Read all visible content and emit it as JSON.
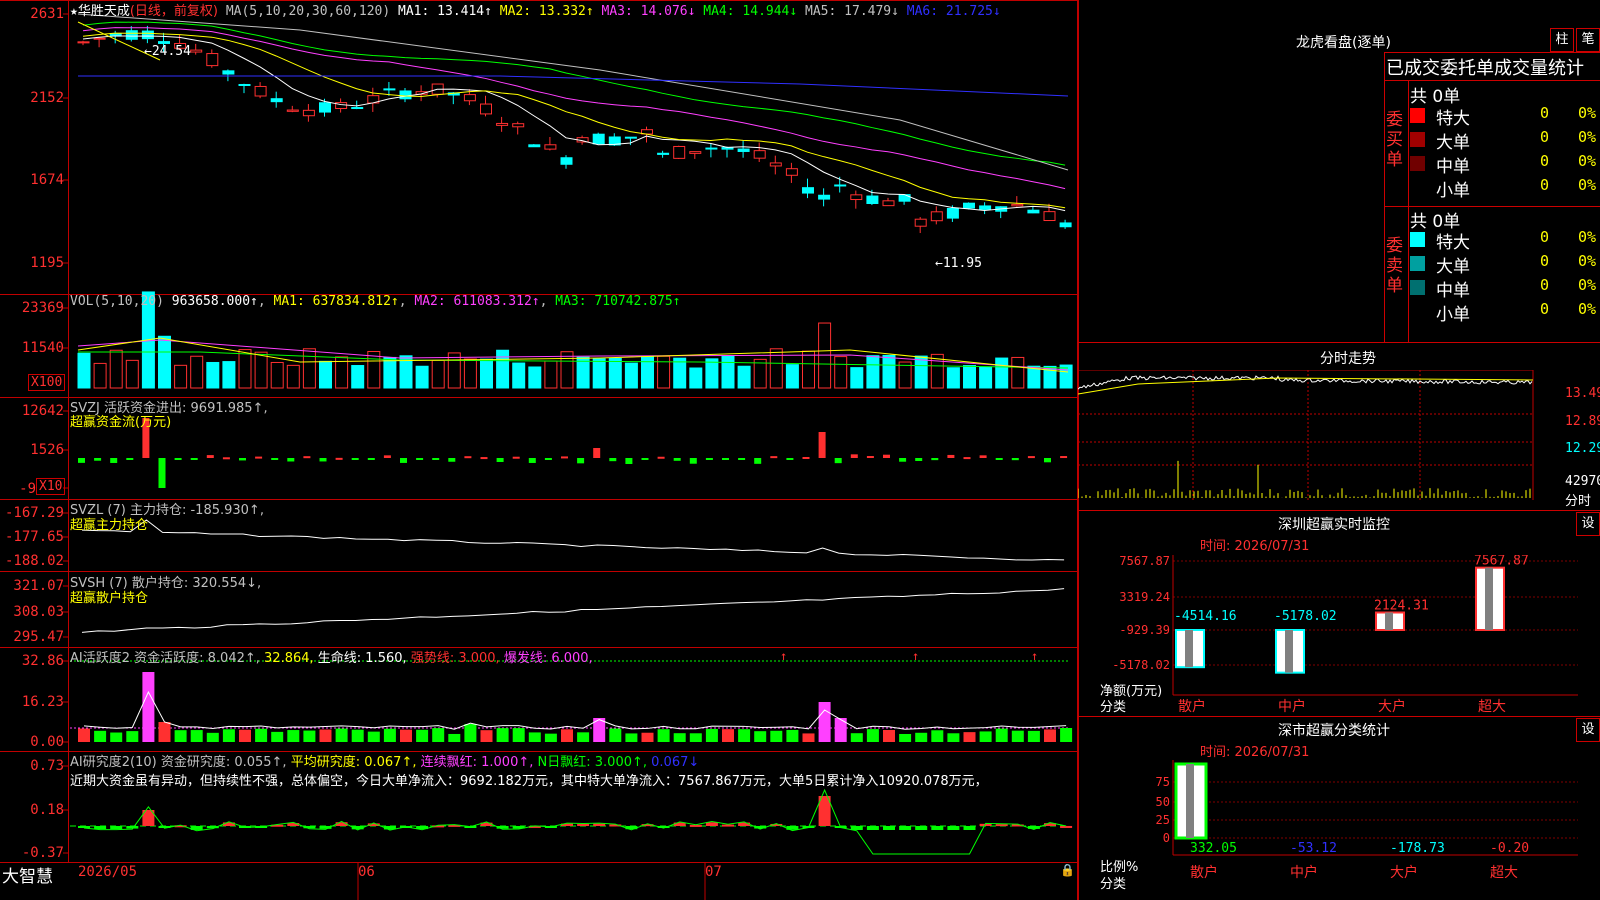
{
  "app": {
    "logo_text": "大智慧"
  },
  "main": {
    "star": "★",
    "stock_name": "华胜天成",
    "period": "(日线，前复权)",
    "ma_params": "MA(5,10,20,30,60,120)",
    "ma1": "MA1: 13.414↑",
    "ma2": "MA2: 13.332↑",
    "ma3": "MA3: 14.076↓",
    "ma4": "MA4: 14.944↓",
    "ma5": "MA5: 17.479↓",
    "ma6": "MA6: 21.725↓",
    "y_labels": [
      "2631",
      "2152",
      "1674",
      "1195"
    ],
    "high_label": "←24.54",
    "low_label": "←11.95"
  },
  "vol": {
    "params": "VOL(5,10,20)",
    "value": "963658.000↑",
    "ma1": "MA1: 637834.812↑",
    "ma2": "MA2: 611083.312↑",
    "ma3": "MA3: 710742.875↑",
    "y_labels": [
      "23369",
      "11540"
    ],
    "unit": "X100"
  },
  "svzj": {
    "title": "SVZJ  活跃资金进出: 9691.985↑,",
    "subtitle": "超赢资金流(万元)",
    "y_labels": [
      "12642",
      "1526",
      "-9"
    ],
    "unit": "X10"
  },
  "svzl": {
    "title": "SVZL (7) 主力持仓: -185.930↑,",
    "subtitle": "超赢主力持仓",
    "y_labels": [
      "-167.29",
      "-177.65",
      "-188.02"
    ]
  },
  "svsh": {
    "title": "SVSH (7) 散户持仓: 320.554↓,",
    "subtitle": "超赢散户持仓",
    "y_labels": [
      "321.07",
      "308.03",
      "295.47"
    ]
  },
  "ai_active": {
    "title": "AI活跃度2 资金活跃度: 8.042↑,",
    "v2": "32.864,",
    "life": "生命线: 1.560,",
    "strong": "强势线: 3.000,",
    "burst": "爆发线: 6.000,",
    "y_labels": [
      "32.86",
      "16.23",
      "0.00"
    ]
  },
  "ai_research": {
    "title": "AI研究度2(10) 资金研究度: 0.055↑,",
    "avg": "平均研究度: 0.067↑,",
    "red_streak": "连续飘红: 1.000↑,",
    "n_red": "N日飘红: 3.000↑,",
    "last": "0.067↓",
    "comment": "近期大资金虽有异动，但持续性不强，总体偏空，今日大单净流入：9692.182万元，其中特大单净流入：7567.867万元，大单5日累计净入10920.078万元，",
    "y_labels": [
      "0.73",
      "0.18",
      "-0.37"
    ]
  },
  "x_axis": {
    "labels": [
      "2026/05",
      "06",
      "07"
    ]
  },
  "right": {
    "lhb_title": "龙虎看盘(逐单)",
    "btn_bar": "柱",
    "btn_pen": "笔",
    "stat_title": "已成交委托单成交量统计",
    "buy_total": "共 0单",
    "sell_total": "共 0单",
    "buy_label": "委买单",
    "sell_label": "委卖单",
    "buy_rows": [
      {
        "name": "特大",
        "count": "0",
        "pct": "0%",
        "color": "#ff0000"
      },
      {
        "name": "大单",
        "count": "0",
        "pct": "0%",
        "color": "#a00000"
      },
      {
        "name": "中单",
        "count": "0",
        "pct": "0%",
        "color": "#700000"
      },
      {
        "name": "小单",
        "count": "0",
        "pct": "0%",
        "color": "#000000"
      }
    ],
    "sell_rows": [
      {
        "name": "特大",
        "count": "0",
        "pct": "0%",
        "color": "#00ffff"
      },
      {
        "name": "大单",
        "count": "0",
        "pct": "0%",
        "color": "#00a0a0"
      },
      {
        "name": "中单",
        "count": "0",
        "pct": "0%",
        "color": "#007070"
      },
      {
        "name": "小单",
        "count": "0",
        "pct": "0%",
        "color": "#000000"
      }
    ],
    "intraday_title": "分时走势",
    "intraday_y": [
      "13.49",
      "12.89",
      "12.29",
      "42970"
    ],
    "intraday_x": "分时",
    "monitor_title": "深圳超赢实时监控",
    "monitor_btn": "设",
    "monitor_time": "时间: 2026/07/31",
    "monitor_y": [
      "7567.87",
      "3319.24",
      "-929.39",
      "-5178.02"
    ],
    "monitor_bar_labels": [
      "-4514.16",
      "-5178.02",
      "2124.31",
      "7567.87"
    ],
    "monitor_ylabel": "净额(万元)",
    "monitor_xlabel": "分类",
    "categories": [
      "散户",
      "中户",
      "大户",
      "超大"
    ],
    "classify_title": "深市超赢分类统计",
    "classify_btn": "设",
    "classify_time": "时间: 2026/07/31",
    "classify_y": [
      "75",
      "50",
      "25",
      "0"
    ],
    "classify_values": [
      "332.05",
      "-53.12",
      "-178.73",
      "-0.20"
    ],
    "classify_ylabel": "比例%",
    "classify_xlabel": "分类"
  },
  "colors": {
    "up": "#ff3030",
    "down": "#00ffff",
    "border": "#c00000"
  }
}
